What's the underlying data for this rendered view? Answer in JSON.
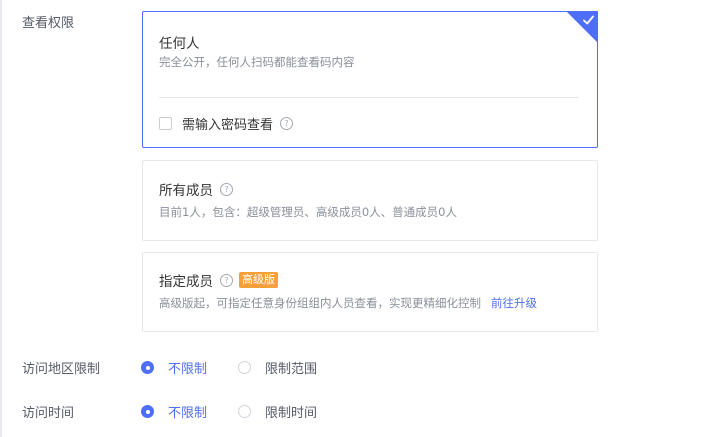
{
  "view_permission": {
    "label": "查看权限",
    "options": [
      {
        "title": "任何人",
        "desc": "完全公开，任何人扫码都能查看码内容",
        "selected": true,
        "password_checkbox_label": "需输入密码查看",
        "password_checkbox_checked": false
      },
      {
        "title": "所有成员",
        "desc": "目前1人，包含：超级管理员、高级成员0人、普通成员0人",
        "selected": false
      },
      {
        "title": "指定成员",
        "badge": "高级版",
        "desc": "高级版起，可指定任意身份组组内人员查看，实现更精细化控制",
        "link": "前往升级",
        "selected": false
      }
    ],
    "help_glyph": "?"
  },
  "region_limit": {
    "label": "访问地区限制",
    "options": [
      "不限制",
      "限制范围"
    ],
    "selected": "不限制"
  },
  "time_limit": {
    "label": "访问时间",
    "options": [
      "不限制",
      "限制时间"
    ],
    "selected": "不限制"
  },
  "colors": {
    "accent": "#4f6ef7",
    "badge": "#f7a03a"
  },
  "icons": [
    "check-icon",
    "help-icon",
    "checkbox-icon",
    "radio-icon"
  ]
}
